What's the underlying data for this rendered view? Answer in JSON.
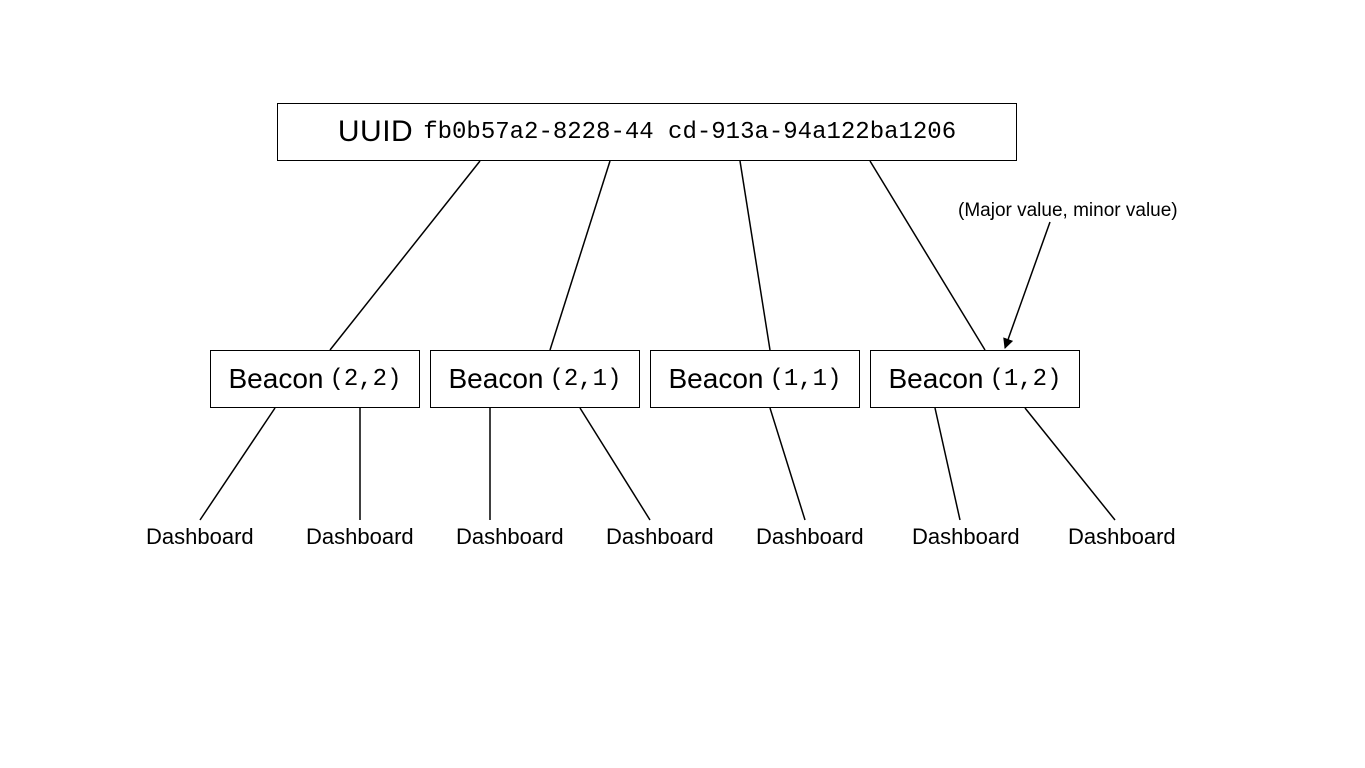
{
  "root": {
    "label": "UUID",
    "value": "fb0b57a2-8228-44 cd-913a-94a122ba1206"
  },
  "annotation": "(Major value, minor value)",
  "beacons": [
    {
      "label": "Beacon",
      "coords": "(2,2)"
    },
    {
      "label": "Beacon",
      "coords": "(2,1)"
    },
    {
      "label": "Beacon",
      "coords": "(1,1)"
    },
    {
      "label": "Beacon",
      "coords": "(1,2)"
    }
  ],
  "dashboards": [
    "Dashboard",
    "Dashboard",
    "Dashboard",
    "Dashboard",
    "Dashboard",
    "Dashboard",
    "Dashboard"
  ]
}
